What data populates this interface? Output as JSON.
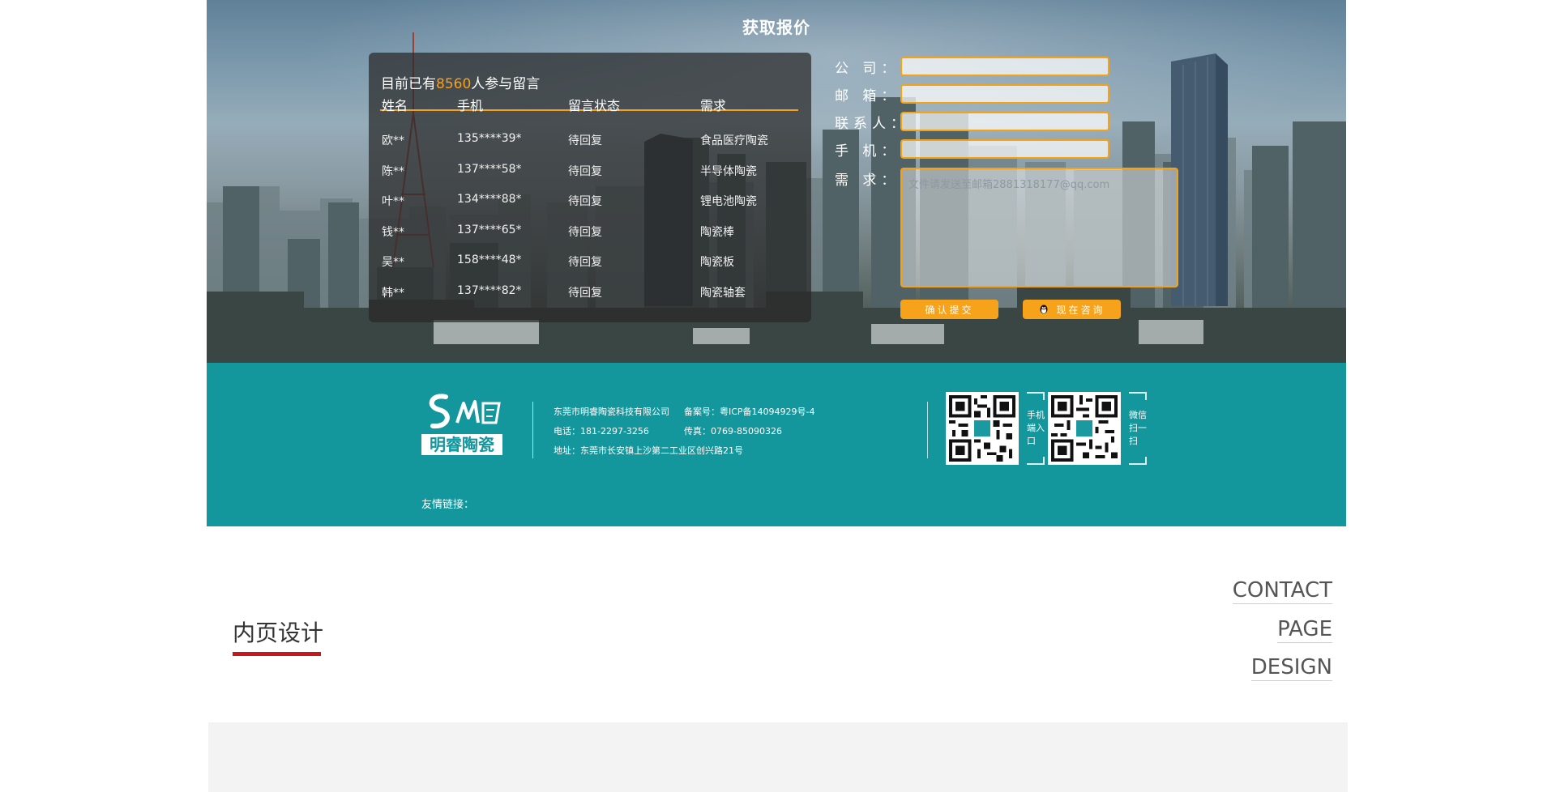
{
  "quote": {
    "title": "获取报价",
    "headline_prefix": "目前已有",
    "headline_count": "8560",
    "headline_suffix": "人参与留言",
    "columns": [
      "姓名",
      "手机",
      "留言状态",
      "需求"
    ],
    "rows": [
      {
        "name": "欧**",
        "phone": "135****39*",
        "status": "待回复",
        "need": "食品医疗陶瓷"
      },
      {
        "name": "陈**",
        "phone": "137****58*",
        "status": "待回复",
        "need": "半导体陶瓷"
      },
      {
        "name": "叶**",
        "phone": "134****88*",
        "status": "待回复",
        "need": "锂电池陶瓷"
      },
      {
        "name": "钱**",
        "phone": "137****65*",
        "status": "待回复",
        "need": "陶瓷棒"
      },
      {
        "name": "吴**",
        "phone": "158****48*",
        "status": "待回复",
        "need": "陶瓷板"
      },
      {
        "name": "韩**",
        "phone": "137****82*",
        "status": "待回复",
        "need": "陶瓷轴套"
      }
    ],
    "form": {
      "company_label": "公  司：",
      "email_label": "邮  箱：",
      "contact_label": "联系人：",
      "phone_label": "手  机：",
      "need_label": "需  求：",
      "need_placeholder": "文件请发送至邮箱2881318177@qq.com",
      "submit_label": "确认提交",
      "consult_label": "现在咨询"
    }
  },
  "footer": {
    "logo_text": "明睿陶瓷",
    "company": "东莞市明睿陶瓷科技有限公司",
    "icp": "备案号：粤ICP备14094929号-4",
    "phone": "电话：181-2297-3256",
    "fax": "传真：0769-85090326",
    "address": "地址：东莞市长安镇上沙第二工业区创兴路21号",
    "qr1_caption": "手机端入口",
    "qr2_caption": "微信扫一扫",
    "links_label": "友情链接："
  },
  "section": {
    "title": "内页设计",
    "en_1": "CONTACT",
    "en_2": "PAGE",
    "en_3": "DESIGN"
  },
  "colors": {
    "accent_orange": "#f5a315",
    "teal": "#14979c",
    "red_underline": "#c8161d"
  }
}
